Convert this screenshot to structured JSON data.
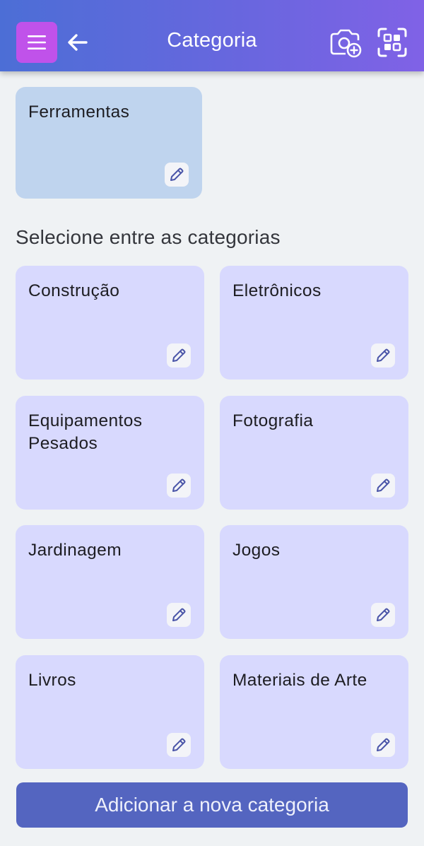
{
  "header": {
    "title": "Categoria",
    "menu_icon": "hamburger-menu-icon",
    "back_icon": "arrow-left-icon",
    "camera_icon": "camera-add-icon",
    "scan_icon": "qr-scan-icon"
  },
  "selected_category": {
    "label": "Ferramentas"
  },
  "section_heading": "Selecione entre as categorias",
  "categories": [
    {
      "label": "Construção"
    },
    {
      "label": "Eletrônicos"
    },
    {
      "label": "Equipamentos Pesados"
    },
    {
      "label": "Fotografia"
    },
    {
      "label": "Jardinagem"
    },
    {
      "label": "Jogos"
    },
    {
      "label": "Livros"
    },
    {
      "label": "Materiais de Arte"
    }
  ],
  "add_button_label": "Adicionar a nova categoria",
  "colors": {
    "header_gradient_start": "#4c6ed6",
    "header_gradient_end": "#8062e6",
    "menu_button": "#c052ea",
    "card": "#d8d9fe",
    "selected_card": "#bfd4ee",
    "primary_button": "#5465c0"
  }
}
